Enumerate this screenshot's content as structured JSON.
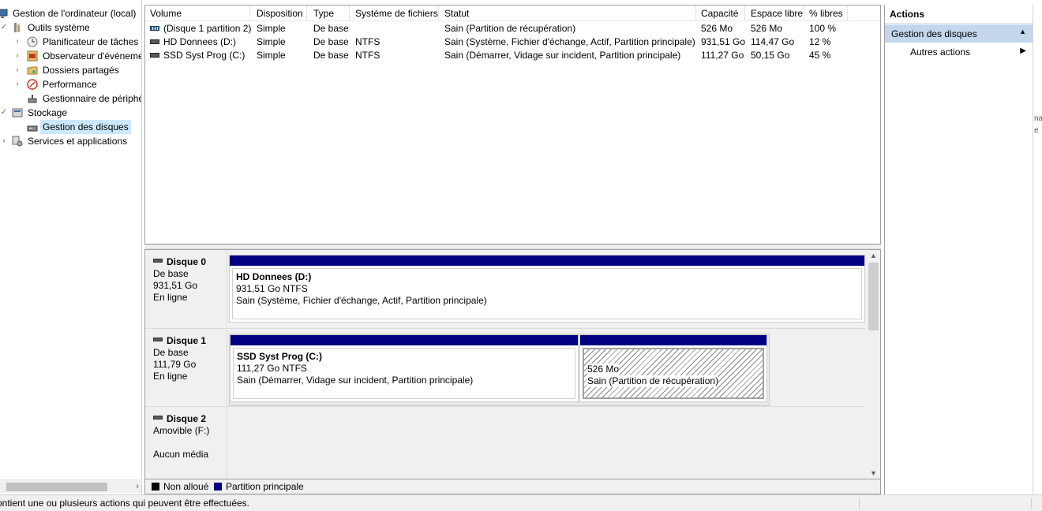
{
  "tree": {
    "items": [
      {
        "label": "Gestion de l'ordinateur (local)",
        "icon": "computer-management-icon"
      },
      {
        "label": "Outils système",
        "icon": "system-tools-icon"
      },
      {
        "label": "Planificateur de tâches",
        "icon": "task-scheduler-icon"
      },
      {
        "label": "Observateur d'événeme",
        "icon": "event-viewer-icon"
      },
      {
        "label": "Dossiers partagés",
        "icon": "shared-folders-icon"
      },
      {
        "label": "Performance",
        "icon": "performance-icon"
      },
      {
        "label": "Gestionnaire de périphé",
        "icon": "device-manager-icon"
      },
      {
        "label": "Stockage",
        "icon": "storage-icon"
      },
      {
        "label": "Gestion des disques",
        "icon": "disk-management-icon"
      },
      {
        "label": "Services et applications",
        "icon": "services-icon"
      }
    ]
  },
  "volumes": {
    "columns": [
      "Volume",
      "Disposition",
      "Type",
      "Système de fichiers",
      "Statut",
      "Capacité",
      "Espace libre",
      "% libres"
    ],
    "rows": [
      [
        "(Disque 1 partition 2)",
        "Simple",
        "De base",
        "",
        "Sain (Partition de récupération)",
        "526 Mo",
        "526 Mo",
        "100 %"
      ],
      [
        "HD Donnees (D:)",
        "Simple",
        "De base",
        "NTFS",
        "Sain (Système, Fichier d'échange, Actif, Partition principale)",
        "931,51 Go",
        "114,47 Go",
        "12 %"
      ],
      [
        "SSD Syst Prog (C:)",
        "Simple",
        "De base",
        "NTFS",
        "Sain (Démarrer, Vidage sur incident, Partition principale)",
        "111,27 Go",
        "50,15 Go",
        "45 %"
      ]
    ]
  },
  "disks": [
    {
      "name": "Disque 0",
      "type": "De base",
      "size": "931,51 Go",
      "state": "En ligne",
      "partitions": [
        {
          "title": "HD Donnees  (D:)",
          "size": "931,51 Go NTFS",
          "status": "Sain (Système, Fichier d'échange, Actif, Partition principale)"
        }
      ]
    },
    {
      "name": "Disque 1",
      "type": "De base",
      "size": "111,79 Go",
      "state": "En ligne",
      "partitions": [
        {
          "title": "SSD Syst Prog  (C:)",
          "size": "111,27 Go NTFS",
          "status": "Sain (Démarrer, Vidage sur incident, Partition principale)"
        },
        {
          "title": "",
          "size": "526 Mo",
          "status": "Sain (Partition de récupération)"
        }
      ]
    },
    {
      "name": "Disque 2",
      "type": "Amovible (F:)",
      "size": "",
      "state": "Aucun média",
      "partitions": []
    }
  ],
  "legend": {
    "unallocated": {
      "label": "Non alloué",
      "color": "#000000"
    },
    "primary": {
      "label": "Partition principale",
      "color": "#000080"
    }
  },
  "actions": {
    "title": "Actions",
    "section": "Gestion des disques",
    "item": "Autres actions"
  },
  "edge_fragments": [
    "na",
    "e"
  ],
  "status_bar": "ontient une ou plusieurs actions qui peuvent être effectuées."
}
